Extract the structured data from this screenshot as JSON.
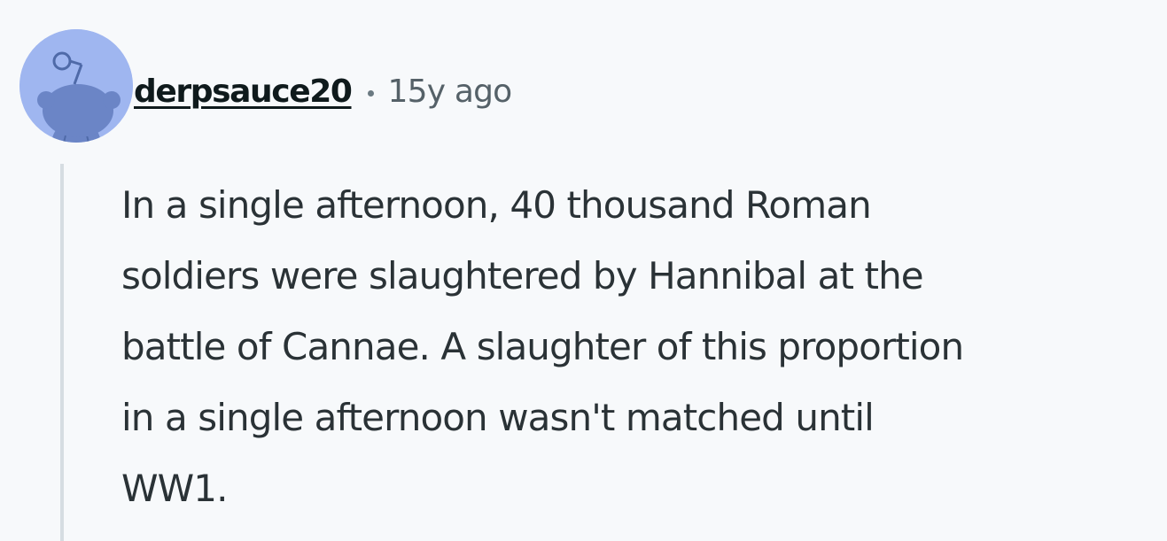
{
  "comment": {
    "author": {
      "username": "derpsauce20",
      "avatar_icon": "snoo-avatar-icon"
    },
    "separator": "•",
    "timestamp": "15y ago",
    "body_lines": [
      "In a single afternoon, 40 thousand Roman",
      "soldiers were slaughtered by Hannibal at the",
      "battle of Cannae. A slaughter of this proportion",
      "in a single afternoon wasn't matched until",
      "WW1."
    ]
  },
  "colors": {
    "background": "#f7f9fb",
    "avatar_background": "#9fb6f0",
    "avatar_figure": "#6b85c6",
    "username": "#0f1a1c",
    "timestamp": "#556168",
    "body_text": "#2a3236",
    "thread_line": "#d6dde2"
  }
}
